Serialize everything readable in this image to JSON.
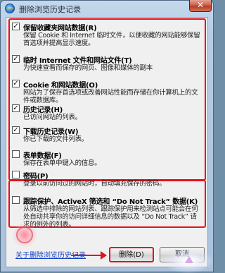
{
  "window": {
    "title": "删除浏览历史记录",
    "close_label": "✕"
  },
  "items": [
    {
      "checked": true,
      "title": "保留收藏夹网站数据(R)",
      "desc": "保留 Cookie 和 Internet 临时文件，以便收藏的网站能够保留首选项并提高显示速度。"
    },
    {
      "checked": true,
      "title": "临时 Internet 文件和网站文件(T)",
      "desc": "为快速查看而保存的网页、图像和媒体的副本"
    },
    {
      "checked": true,
      "title": "Cookie 和网站数据(O)",
      "desc": "网站为了保存首选项或改善网站性能而存储在你计算机上的文件或数据库。"
    },
    {
      "checked": true,
      "title": "历史记录(H)",
      "desc": "已访问网站的列表。"
    },
    {
      "checked": true,
      "title": "下载历史记录(W)",
      "desc": "你已下载的文件列表。"
    },
    {
      "checked": false,
      "title": "表单数据(F)",
      "desc": "保存在表单中键入的信息。"
    },
    {
      "checked": false,
      "title": "密码(P)",
      "desc": "登录以前访问过的网站时，自动填充保存的密码。"
    },
    {
      "checked": false,
      "title": "跟踪保护、ActiveX 筛选和 “Do Not Track” 数据(K)",
      "desc": "从筛选中排除的网站列表、跟踪保护用来检测站点可能会在何处自动共享你的访问详细信息的数据以及 “Do Not Track” 请求的例外的列表。"
    }
  ],
  "footer": {
    "link_text": "关于删除浏览历史记录",
    "delete_label": "删除(D)",
    "cancel_label": "取消"
  }
}
